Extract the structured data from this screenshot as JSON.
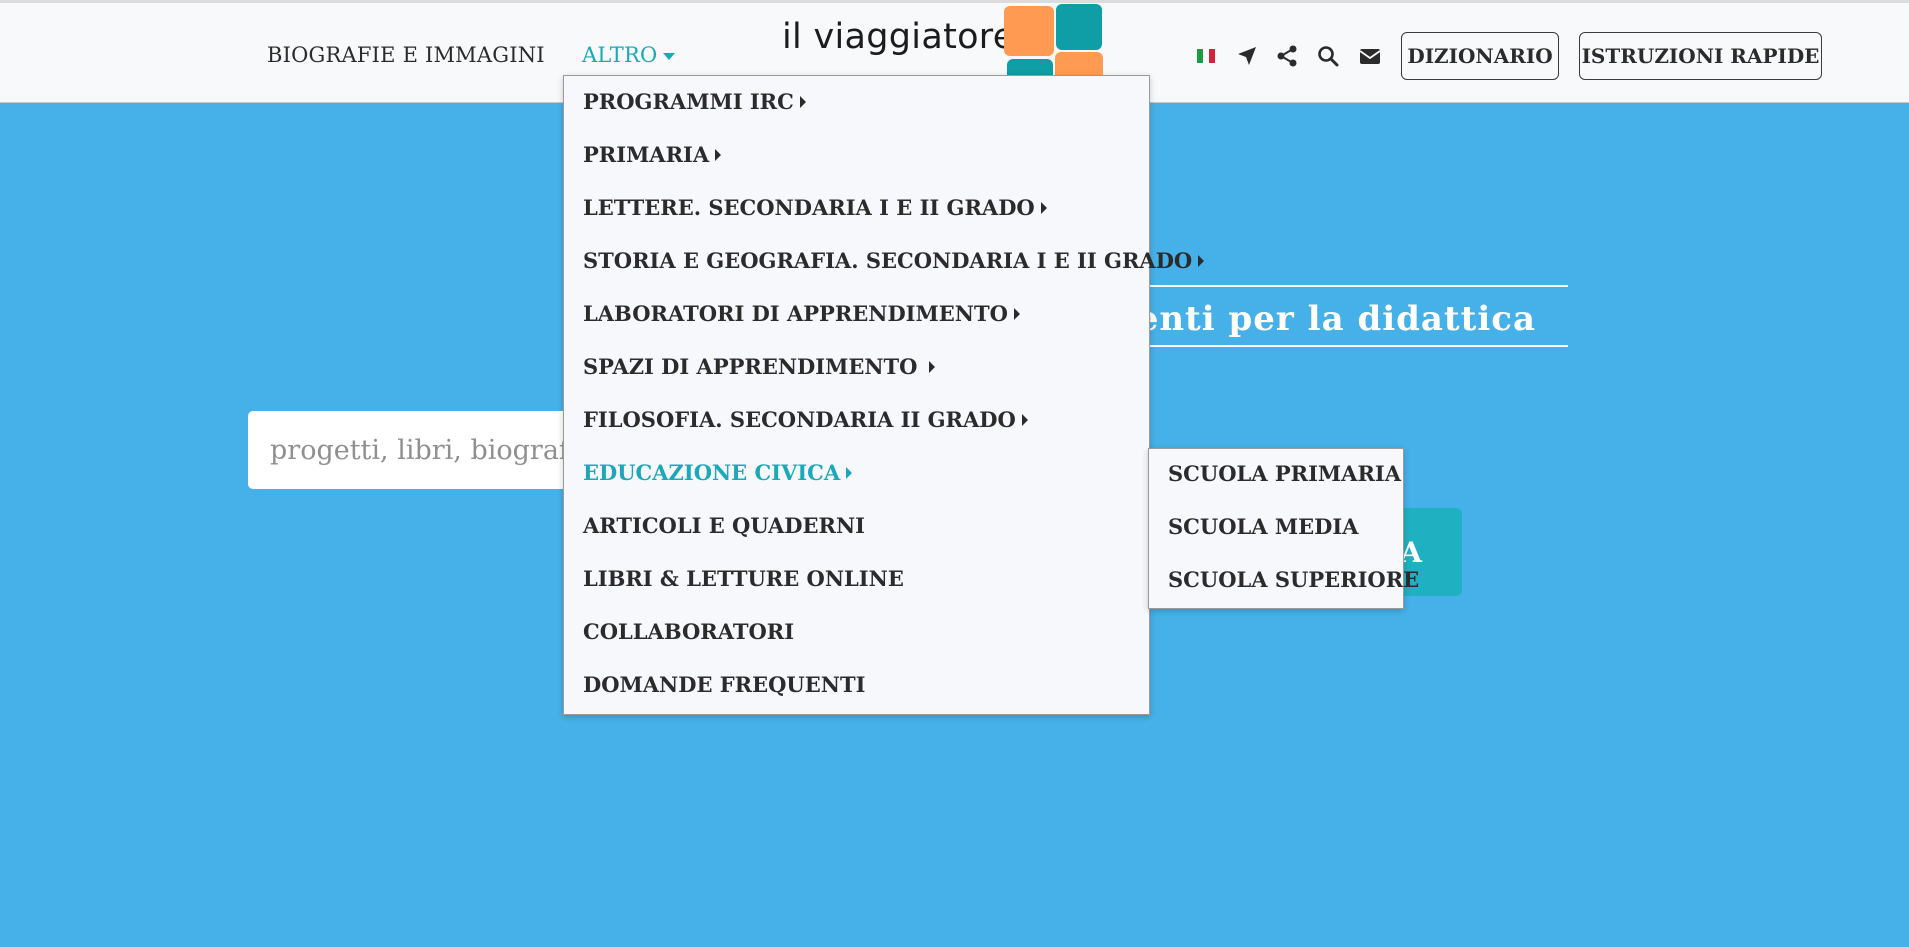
{
  "header": {
    "nav": [
      {
        "label": "BIOGRAFIE E IMMAGINI"
      },
      {
        "label": "ALTRO"
      }
    ],
    "logo_text": "il viaggiatore",
    "icons": [
      "italian-flag-icon",
      "location-arrow-icon",
      "share-icon",
      "search-icon",
      "envelope-icon"
    ],
    "buttons": {
      "dizionario": "DIZIONARIO",
      "istruzioni": "ISTRUZIONI RAPIDE"
    },
    "colors": {
      "accent": "#1ba8b8",
      "logo_orange": "#ff9a52",
      "logo_teal": "#0f9da6"
    }
  },
  "hero": {
    "tagline": "umenti per la didattica",
    "search_placeholder": "progetti, libri, biografie,",
    "search_button": "A",
    "background": "#46b1e8"
  },
  "menu": {
    "items": [
      {
        "label": "PROGRAMMI IRC",
        "has_submenu": true
      },
      {
        "label": "PRIMARIA",
        "has_submenu": true
      },
      {
        "label": "LETTERE. SECONDARIA I E II GRADO",
        "has_submenu": true
      },
      {
        "label": "STORIA E GEOGRAFIA. SECONDARIA I E II GRADO",
        "has_submenu": true
      },
      {
        "label": "LABORATORI DI APPRENDIMENTO",
        "has_submenu": true
      },
      {
        "label": "SPAZI DI APPRENDIMENTO ",
        "has_submenu": true
      },
      {
        "label": "FILOSOFIA. SECONDARIA II GRADO",
        "has_submenu": true
      },
      {
        "label": "EDUCAZIONE CIVICA",
        "has_submenu": true
      },
      {
        "label": "ARTICOLI E QUADERNI",
        "has_submenu": false
      },
      {
        "label": "LIBRI & LETTURE ONLINE",
        "has_submenu": false
      },
      {
        "label": "COLLABORATORI",
        "has_submenu": false
      },
      {
        "label": "DOMANDE FREQUENTI",
        "has_submenu": false
      }
    ],
    "submenu": [
      {
        "label": "SCUOLA PRIMARIA"
      },
      {
        "label": "SCUOLA MEDIA"
      },
      {
        "label": "SCUOLA SUPERIORE"
      }
    ]
  }
}
